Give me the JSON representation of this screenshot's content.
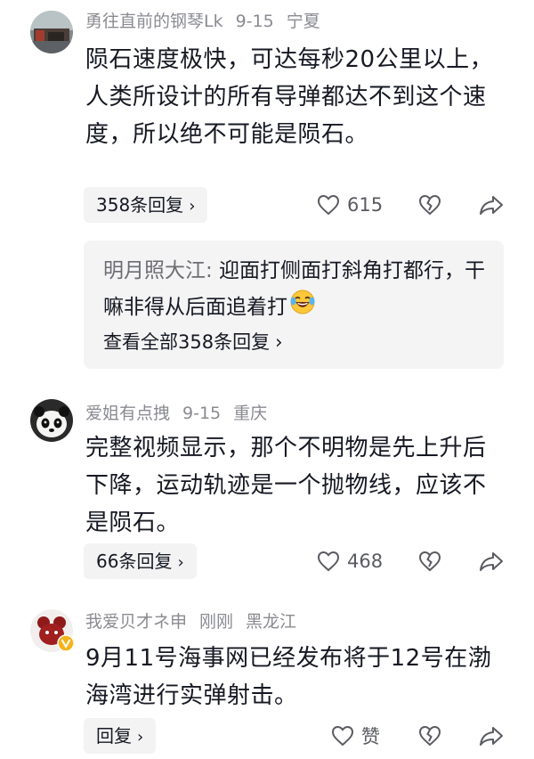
{
  "comments": [
    {
      "user": "勇往直前的钢琴Lk",
      "date": "9-15",
      "location": "宁夏",
      "text": "陨石速度极快，可达每秒20公里以上，人类所设计的所有导弹都达不到这个速度，所以绝不可能是陨石。",
      "reply_label": "358条回复",
      "likes": "615",
      "sub_reply": {
        "author": "明月照大江:",
        "text": " 迎面打侧面打斜角打都行，干嘛非得从后面追着打",
        "emoji": "laughing-tears-emoji",
        "view_all": "查看全部358条回复"
      }
    },
    {
      "user": "爱姐有点拽",
      "date": "9-15",
      "location": "重庆",
      "text": "完整视频显示，那个不明物是先上升后下降，运动轨迹是一个抛物线，应该不是陨石。",
      "reply_label": "66条回复",
      "likes": "468"
    },
    {
      "user": "我爱贝才ネ申",
      "date": "刚刚",
      "location": "黑龙江",
      "text": "9月11号海事网已经发布将于12号在渤海湾进行实弹射击。",
      "reply_label": "回复",
      "likes": "赞"
    }
  ],
  "icons": {
    "like": "heart-outline-icon",
    "dislike": "broken-heart-icon",
    "share": "share-arrow-icon",
    "chevron": "chevron-right-icon"
  },
  "colors": {
    "meta": "#8a8b91",
    "reply_bg": "#f3f3f4",
    "sub_bg": "#f4f4f5",
    "text": "#161823"
  },
  "glyphs": {
    "chevron": "›"
  }
}
